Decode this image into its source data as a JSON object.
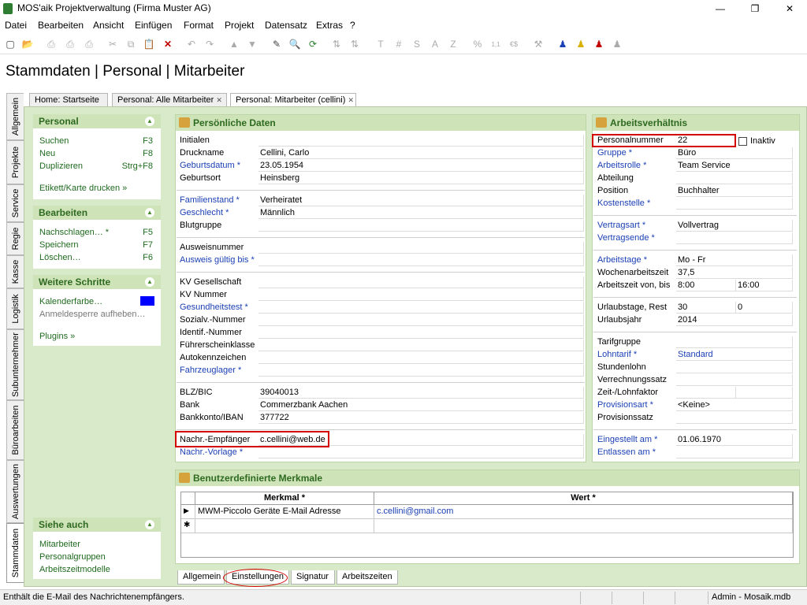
{
  "window": {
    "title": "MOS'aik Projektverwaltung (Firma Muster AG)",
    "minimize": "—",
    "maximize": "❐",
    "close": "✕"
  },
  "menu": [
    "Datei",
    "Bearbeiten",
    "Ansicht",
    "Einfügen",
    "Format",
    "Projekt",
    "Datensatz",
    "Extras",
    "?"
  ],
  "toolbar": {
    "icons": [
      "new-icon",
      "open-icon",
      "print-preview-icon",
      "print-icon",
      "print-settings-icon",
      "cut-icon",
      "copy-icon",
      "paste-icon",
      "delete-icon",
      "undo-icon",
      "redo-icon",
      "up-icon",
      "down-icon",
      "edit-icon",
      "find-icon",
      "refresh-icon",
      "sort-asc-icon",
      "sort-desc-icon",
      "T",
      "#",
      "S",
      "A",
      "Z",
      "%",
      "1,1",
      "€$",
      "tools-icon",
      "user-blue-icon",
      "user-yellow-icon",
      "user-red-icon",
      "user-gray-icon"
    ],
    "labels": {
      "t": "T",
      "hash": "#",
      "s": "S",
      "a": "A",
      "z": "Z",
      "pct": "%",
      "num": "1,1",
      "cur": "€$"
    }
  },
  "heading": "Stammdaten | Personal | Mitarbeiter",
  "vtabs": [
    "Allgemein",
    "Projekte",
    "Service",
    "Regie",
    "Kasse",
    "Logistik",
    "Subunternehmer",
    "Büroarbeiten",
    "Auswertungen",
    "Stammdaten"
  ],
  "tabs": {
    "home": "Home: Startseite",
    "alle": "Personal: Alle Mitarbeiter",
    "mit": "Personal: Mitarbeiter (cellini)",
    "close": "✕"
  },
  "side": {
    "personal": {
      "title": "Personal",
      "suchen": "Suchen",
      "suchen_k": "F3",
      "neu": "Neu",
      "neu_k": "F8",
      "dup": "Duplizieren",
      "dup_k": "Strg+F8",
      "etikett": "Etikett/Karte drucken »"
    },
    "bearbeiten": {
      "title": "Bearbeiten",
      "nach": "Nachschlagen… *",
      "nach_k": "F5",
      "speichern": "Speichern",
      "speichern_k": "F7",
      "loeschen": "Löschen…",
      "loeschen_k": "F6"
    },
    "weitere": {
      "title": "Weitere Schritte",
      "kal": "Kalenderfarbe…",
      "kal_color": "#0000ff",
      "anm": "Anmeldesperre aufheben…",
      "plugins": "Plugins »"
    },
    "siehe": {
      "title": "Siehe auch",
      "mit": "Mitarbeiter",
      "grp": "Personalgruppen",
      "azm": "Arbeitszeitmodelle"
    },
    "collapse": "▲"
  },
  "pd": {
    "title": "Persönliche Daten",
    "initialen": {
      "label": "Initialen",
      "value": ""
    },
    "druckname": {
      "label": "Druckname",
      "value": "Cellini, Carlo"
    },
    "geburtsdatum": {
      "label": "Geburtsdatum *",
      "value": "23.05.1954"
    },
    "geburtsort": {
      "label": "Geburtsort",
      "value": "Heinsberg"
    },
    "familienstand": {
      "label": "Familienstand *",
      "value": "Verheiratet"
    },
    "geschlecht": {
      "label": "Geschlecht *",
      "value": "Männlich"
    },
    "blutgruppe": {
      "label": "Blutgruppe",
      "value": ""
    },
    "ausweisnr": {
      "label": "Ausweisnummer",
      "value": ""
    },
    "ausweisgueltig": {
      "label": "Ausweis gültig bis *",
      "value": ""
    },
    "kvges": {
      "label": "KV Gesellschaft",
      "value": ""
    },
    "kvnr": {
      "label": "KV Nummer",
      "value": ""
    },
    "gesundheit": {
      "label": "Gesundheitstest *",
      "value": ""
    },
    "sozial": {
      "label": "Sozialv.-Nummer",
      "value": ""
    },
    "identif": {
      "label": "Identif.-Nummer",
      "value": ""
    },
    "fuehrer": {
      "label": "Führerscheinklasse",
      "value": ""
    },
    "auto": {
      "label": "Autokennzeichen",
      "value": ""
    },
    "fahrzeug": {
      "label": "Fahrzeuglager *",
      "value": ""
    },
    "blz": {
      "label": "BLZ/BIC",
      "value": "39040013"
    },
    "bank": {
      "label": "Bank",
      "value": "Commerzbank Aachen"
    },
    "konto": {
      "label": "Bankkonto/IBAN",
      "value": "377722"
    },
    "nachremp": {
      "label": "Nachr.-Empfänger",
      "value": "c.cellini@web.de"
    },
    "nachrvor": {
      "label": "Nachr.-Vorlage *",
      "value": ""
    }
  },
  "av": {
    "title": "Arbeitsverhältnis",
    "pnr": {
      "label": "Personalnummer",
      "value": "22"
    },
    "inaktiv": "Inaktiv",
    "gruppe": {
      "label": "Gruppe *",
      "value": "Büro"
    },
    "rolle": {
      "label": "Arbeitsrolle *",
      "value": "Team Service"
    },
    "abteilung": {
      "label": "Abteilung",
      "value": ""
    },
    "position": {
      "label": "Position",
      "value": "Buchhalter"
    },
    "kosten": {
      "label": "Kostenstelle *",
      "value": ""
    },
    "vertragsart": {
      "label": "Vertragsart *",
      "value": "Vollvertrag"
    },
    "vertragsende": {
      "label": "Vertragsende *",
      "value": ""
    },
    "tage": {
      "label": "Arbeitstage *",
      "value": "Mo - Fr"
    },
    "wochen": {
      "label": "Wochenarbeitszeit",
      "value": "37,5"
    },
    "zeit": {
      "label": "Arbeitszeit von, bis",
      "von": "8:00",
      "bis": "16:00"
    },
    "urlaub": {
      "label": "Urlaubstage, Rest",
      "tage": "30",
      "rest": "0"
    },
    "urlaubsjahr": {
      "label": "Urlaubsjahr",
      "value": "2014"
    },
    "tarif": {
      "label": "Tarifgruppe",
      "value": ""
    },
    "lohntarif": {
      "label": "Lohntarif *",
      "value": "Standard"
    },
    "stundenlohn": {
      "label": "Stundenlohn",
      "value": ""
    },
    "verrechnung": {
      "label": "Verrechnungssatz",
      "value": ""
    },
    "faktor": {
      "label": "Zeit-/Lohnfaktor",
      "value": ""
    },
    "provart": {
      "label": "Provisionsart *",
      "value": "<Keine>"
    },
    "provsatz": {
      "label": "Provisionssatz",
      "value": ""
    },
    "eingestellt": {
      "label": "Eingestellt am *",
      "value": "01.06.1970"
    },
    "entlassen": {
      "label": "Entlassen am *",
      "value": ""
    }
  },
  "merkmale": {
    "title": "Benutzerdefinierte Merkmale",
    "col1": "Merkmal *",
    "col2": "Wert *",
    "rows": [
      {
        "merkmal": "MWM-Piccolo Geräte E-Mail Adresse",
        "wert": "c.cellini@gmail.com"
      }
    ],
    "current": "▶",
    "new": "✱"
  },
  "bottom_tabs": [
    "Allgemein",
    "Einstellungen",
    "Signatur",
    "Arbeitszeiten"
  ],
  "status": {
    "text": "Enthält die E-Mail des Nachrichtenempfängers.",
    "user": "Admin - Mosaik.mdb"
  }
}
